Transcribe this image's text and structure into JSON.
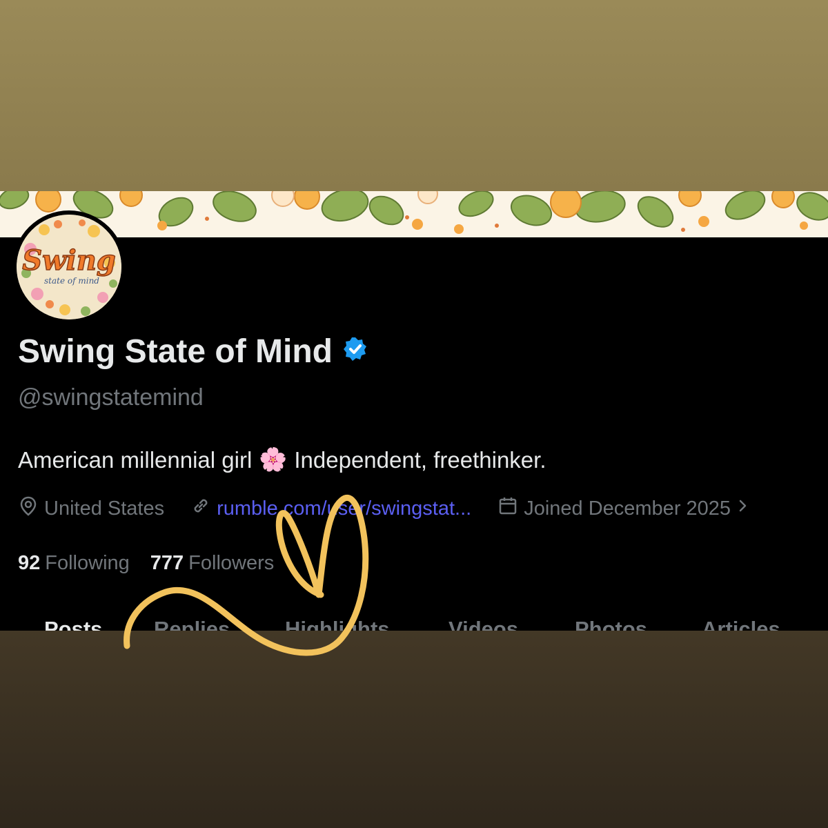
{
  "profile": {
    "display_name": "Swing State of Mind",
    "verified_icon": "verified-badge-icon",
    "handle": "@swingstatemind",
    "bio_before": "American millennial girl",
    "bio_emoji": "🌸",
    "bio_after": "Independent, freethinker.",
    "avatar": {
      "logo_text": "Swing",
      "logo_subtext": "state of mind"
    },
    "location": "United States",
    "website": "rumble.com/user/swingstat...",
    "joined": "Joined December 2025",
    "following_count": "92",
    "following_label": "Following",
    "followers_count": "777",
    "followers_label": "Followers"
  },
  "tabs": [
    {
      "label": "Posts",
      "active": true
    },
    {
      "label": "Replies",
      "active": false
    },
    {
      "label": "Highlights",
      "active": false
    },
    {
      "label": "Videos",
      "active": false
    },
    {
      "label": "Photos",
      "active": false
    },
    {
      "label": "Articles",
      "active": false
    }
  ],
  "colors": {
    "background": "#000000",
    "primary_text": "#e7e9ea",
    "secondary_text": "#71767b",
    "link": "#5b5ff2",
    "verified_blue": "#1d9bf0",
    "doodle_yellow": "#f2c25c",
    "frame_top": "#9a8a58",
    "frame_bottom": "#3a3022"
  },
  "icons": [
    "location-pin-icon",
    "link-icon",
    "calendar-icon",
    "chevron-right-icon",
    "verified-badge-icon"
  ]
}
